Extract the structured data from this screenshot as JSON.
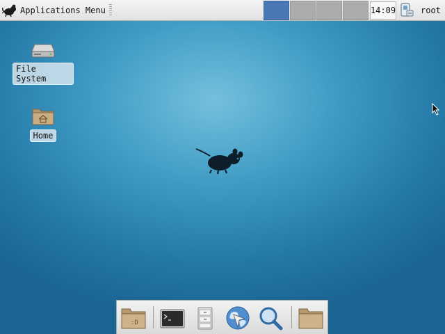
{
  "top_panel": {
    "app_menu_label": "Applications Menu",
    "workspaces": [
      {
        "id": "1",
        "active": true
      },
      {
        "id": "2",
        "active": false
      },
      {
        "id": "3",
        "active": false
      },
      {
        "id": "4",
        "active": false
      }
    ],
    "clock": "14:09",
    "user": "root"
  },
  "desktop": {
    "icons": [
      {
        "label": "File System",
        "icon": "drive-icon"
      },
      {
        "label": "Home",
        "icon": "home-folder-icon"
      }
    ]
  },
  "dock": {
    "items": [
      {
        "name": "file-manager-launcher",
        "icon": "folder-icon"
      },
      {
        "name": "terminal-launcher",
        "icon": "terminal-icon"
      },
      {
        "name": "archive-launcher",
        "icon": "file-cabinet-icon"
      },
      {
        "name": "web-browser-launcher",
        "icon": "globe-icon"
      },
      {
        "name": "app-finder-launcher",
        "icon": "magnifier-icon"
      },
      {
        "name": "folder-launcher",
        "icon": "folder-icon"
      }
    ]
  },
  "colors": {
    "workspace_active": "#4a78b4",
    "workspace_inactive": "#acacac",
    "desktop_base": "#2478a6"
  }
}
